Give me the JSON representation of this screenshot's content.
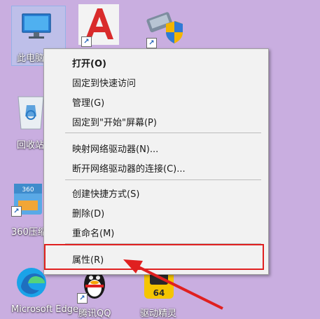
{
  "desktop": {
    "icons": [
      {
        "label": "此电脑",
        "icon": "computer-icon"
      },
      {
        "label": "回收站",
        "icon": "recycle-bin-icon"
      },
      {
        "label": "360压缩",
        "icon": "zip-archive-icon"
      },
      {
        "label": "Microsoft Edge",
        "icon": "edge-icon"
      },
      {
        "label": "腾讯QQ",
        "icon": "qq-penguin-icon"
      },
      {
        "label": "驱动精灵",
        "icon": "driver-64-icon"
      },
      {
        "label": "",
        "icon": "autocad-icon"
      },
      {
        "label": "",
        "icon": "control-panel-shield-icon"
      }
    ]
  },
  "context_menu": {
    "items": [
      {
        "label": "打开(O)",
        "bold": true
      },
      {
        "label": "固定到快速访问"
      },
      {
        "label": "管理(G)"
      },
      {
        "label": "固定到\"开始\"屏幕(P)"
      },
      {
        "label": "映射网络驱动器(N)..."
      },
      {
        "label": "断开网络驱动器的连接(C)..."
      },
      {
        "label": "创建快捷方式(S)"
      },
      {
        "label": "删除(D)"
      },
      {
        "label": "重命名(M)"
      },
      {
        "label": "属性(R)"
      }
    ]
  },
  "annotation": {
    "color": "#e02020"
  }
}
